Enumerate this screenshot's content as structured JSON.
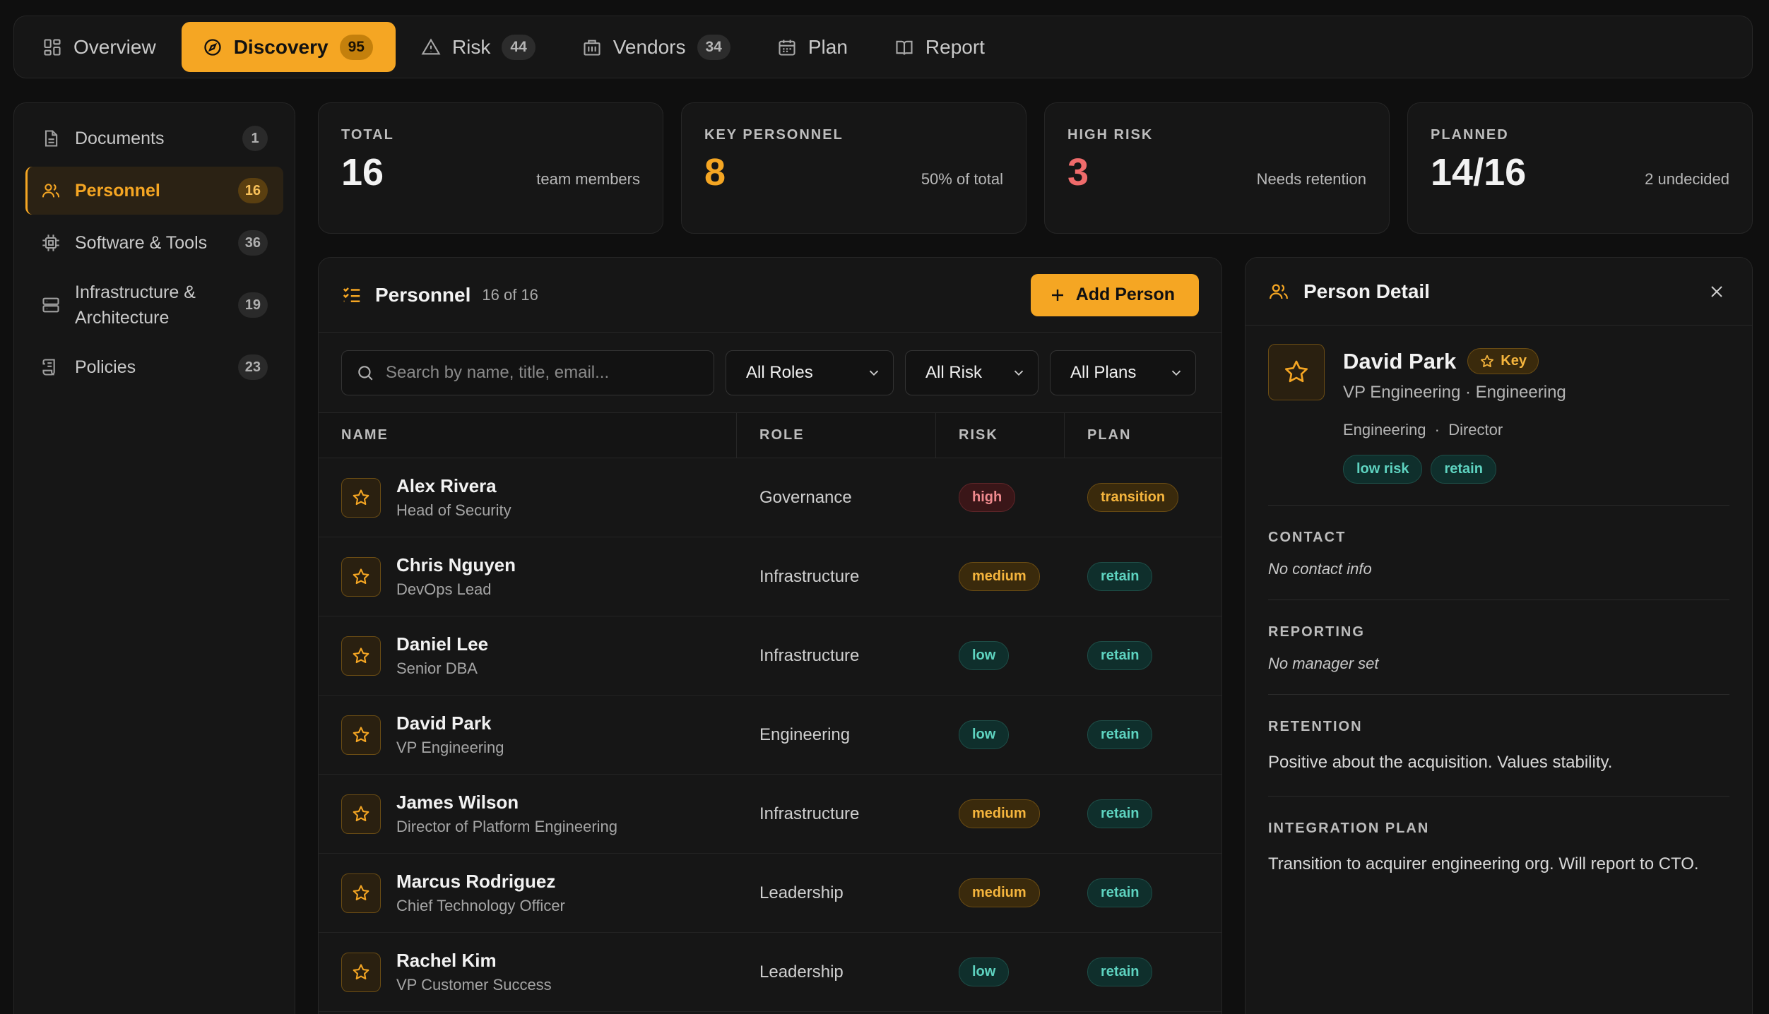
{
  "nav": {
    "tabs": [
      {
        "label": "Overview",
        "icon": "grid-icon"
      },
      {
        "label": "Discovery",
        "icon": "compass-icon",
        "count": "95"
      },
      {
        "label": "Risk",
        "icon": "alert-triangle-icon",
        "count": "44"
      },
      {
        "label": "Vendors",
        "icon": "building-icon",
        "count": "34"
      },
      {
        "label": "Plan",
        "icon": "calendar-icon"
      },
      {
        "label": "Report",
        "icon": "book-open-icon"
      }
    ]
  },
  "sidebar": {
    "items": [
      {
        "label": "Documents",
        "count": "1",
        "icon": "file-icon"
      },
      {
        "label": "Personnel",
        "count": "16",
        "icon": "users-icon"
      },
      {
        "label": "Software & Tools",
        "count": "36",
        "icon": "chip-icon"
      },
      {
        "label": "Infrastructure & Architecture",
        "count": "19",
        "icon": "server-icon"
      },
      {
        "label": "Policies",
        "count": "23",
        "icon": "scroll-icon"
      }
    ]
  },
  "stats": [
    {
      "label": "TOTAL",
      "value": "16",
      "sub": "team members",
      "color": "#f2f2f2"
    },
    {
      "label": "KEY PERSONNEL",
      "value": "8",
      "sub": "50% of total",
      "color": "#f5a623"
    },
    {
      "label": "HIGH RISK",
      "value": "3",
      "sub": "Needs retention",
      "color": "#ef6b6b"
    },
    {
      "label": "PLANNED",
      "value": "14/16",
      "sub": "2 undecided",
      "color": "#f2f2f2"
    }
  ],
  "personnel": {
    "title": "Personnel",
    "meta": "16 of 16",
    "add_label": "Add Person",
    "search_placeholder": "Search by name, title, email...",
    "filters": {
      "roles": "All Roles",
      "risk": "All Risk",
      "plans": "All Plans"
    },
    "columns": {
      "name": "NAME",
      "role": "ROLE",
      "risk": "RISK",
      "plan": "PLAN"
    },
    "rows": [
      {
        "name": "Alex Rivera",
        "title": "Head of Security",
        "role": "Governance",
        "risk": "high",
        "plan": "transition"
      },
      {
        "name": "Chris Nguyen",
        "title": "DevOps Lead",
        "role": "Infrastructure",
        "risk": "medium",
        "plan": "retain"
      },
      {
        "name": "Daniel Lee",
        "title": "Senior DBA",
        "role": "Infrastructure",
        "risk": "low",
        "plan": "retain"
      },
      {
        "name": "David Park",
        "title": "VP Engineering",
        "role": "Engineering",
        "risk": "low",
        "plan": "retain"
      },
      {
        "name": "James Wilson",
        "title": "Director of Platform Engineering",
        "role": "Infrastructure",
        "risk": "medium",
        "plan": "retain"
      },
      {
        "name": "Marcus Rodriguez",
        "title": "Chief Technology Officer",
        "role": "Leadership",
        "risk": "medium",
        "plan": "retain"
      },
      {
        "name": "Rachel Kim",
        "title": "VP Customer Success",
        "role": "Leadership",
        "risk": "low",
        "plan": "retain"
      }
    ]
  },
  "detail": {
    "title": "Person Detail",
    "name": "David Park",
    "key_label": "Key",
    "subtitle": "VP Engineering · Engineering",
    "meta": "Engineering  ·  Director",
    "risk_badge": "low risk",
    "plan_badge": "retain",
    "contact_h": "CONTACT",
    "contact": "No contact info",
    "reporting_h": "REPORTING",
    "reporting": "No manager set",
    "retention_h": "RETENTION",
    "retention": "Positive about the acquisition. Values stability.",
    "integration_h": "INTEGRATION PLAN",
    "integration": "Transition to acquirer engineering org. Will report to CTO."
  }
}
